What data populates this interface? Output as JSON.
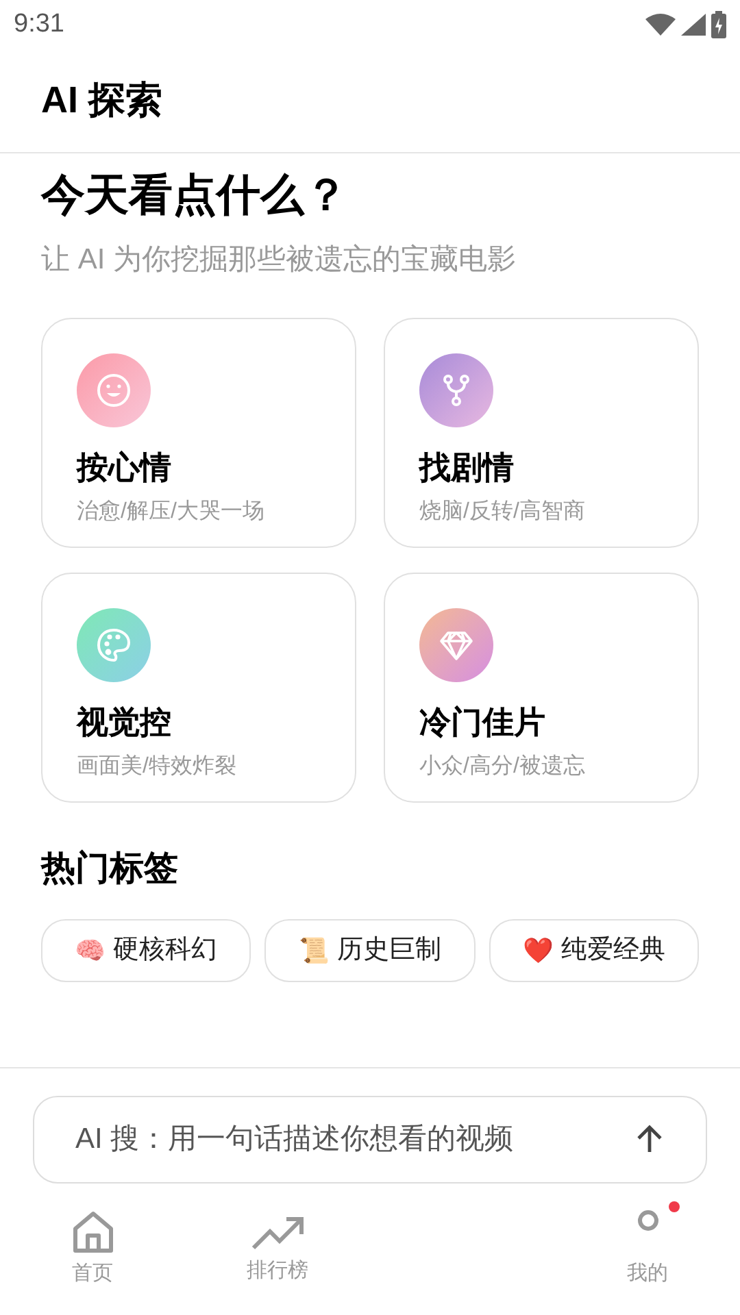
{
  "status_bar": {
    "time": "9:31"
  },
  "header": {
    "title": "AI 探索"
  },
  "hero": {
    "title": "今天看点什么？",
    "subtitle": "让 AI 为你挖掘那些被遗忘的宝藏电影"
  },
  "categories": [
    {
      "kind": "smile",
      "title": "按心情",
      "subtitle": "治愈/解压/大哭一场",
      "color": "#f9a3b4"
    },
    {
      "kind": "branch",
      "title": "找剧情",
      "subtitle": "烧脑/反转/高智商",
      "color": "#b995dc"
    },
    {
      "kind": "palette",
      "title": "视觉控",
      "subtitle": "画面美/特效炸裂",
      "color": "#86e0c0"
    },
    {
      "kind": "gem",
      "title": "冷门佳片",
      "subtitle": "小众/高分/被遗忘",
      "color": "#eaa3c0"
    }
  ],
  "hot_tags": {
    "title": "热门标签",
    "tags": [
      {
        "emoji": "🧠",
        "label": "硬核科幻"
      },
      {
        "emoji": "📜",
        "label": "历史巨制"
      },
      {
        "emoji": "❤️",
        "label": "纯爱经典"
      }
    ]
  },
  "search": {
    "placeholder": "AI 搜：用一句话描述你想看的视频"
  },
  "bottom_nav": [
    {
      "kind": "home",
      "label": "首页",
      "badge": false
    },
    {
      "kind": "trend",
      "label": "排行榜",
      "badge": false
    },
    {
      "kind": "user",
      "label": "我的",
      "badge": true
    }
  ]
}
